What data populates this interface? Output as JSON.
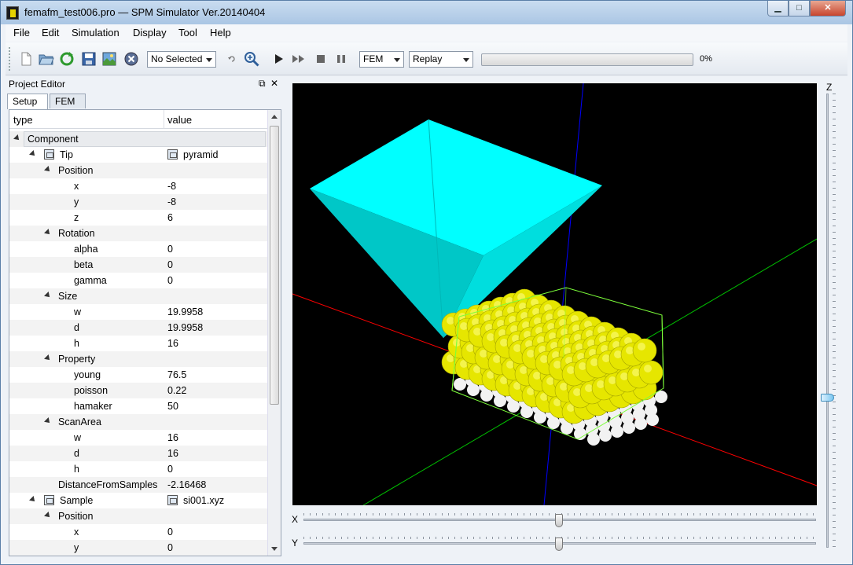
{
  "window": {
    "title": "femafm_test006.pro — SPM Simulator Ver.20140404",
    "min_glyph": "▁",
    "max_glyph": "□",
    "close_glyph": "✕"
  },
  "menu": [
    "File",
    "Edit",
    "Simulation",
    "Display",
    "Tool",
    "Help"
  ],
  "toolbar": {
    "selection_combo": "No Selected",
    "mode_combo": "FEM",
    "replay_combo": "Replay",
    "progress_value": 0,
    "progress_text": "0%"
  },
  "project_editor": {
    "title": "Project Editor",
    "float_glyph": "⧉",
    "close_glyph": "✕",
    "tabs": [
      "Setup",
      "FEM"
    ],
    "columns": {
      "type": "type",
      "value": "value"
    },
    "rows": [
      {
        "label": "Component",
        "value": ""
      },
      {
        "label": "Tip",
        "value": "pyramid"
      },
      {
        "label": "Position",
        "value": ""
      },
      {
        "label": "x",
        "value": "-8"
      },
      {
        "label": "y",
        "value": "-8"
      },
      {
        "label": "z",
        "value": "6"
      },
      {
        "label": "Rotation",
        "value": ""
      },
      {
        "label": "alpha",
        "value": "0"
      },
      {
        "label": "beta",
        "value": "0"
      },
      {
        "label": "gamma",
        "value": "0"
      },
      {
        "label": "Size",
        "value": ""
      },
      {
        "label": "w",
        "value": "19.9958"
      },
      {
        "label": "d",
        "value": "19.9958"
      },
      {
        "label": "h",
        "value": "16"
      },
      {
        "label": "Property",
        "value": ""
      },
      {
        "label": "young",
        "value": "76.5"
      },
      {
        "label": "poisson",
        "value": "0.22"
      },
      {
        "label": "hamaker",
        "value": "50"
      },
      {
        "label": "ScanArea",
        "value": ""
      },
      {
        "label": "w",
        "value": "16"
      },
      {
        "label": "d",
        "value": "16"
      },
      {
        "label": "h",
        "value": "0"
      },
      {
        "label": "DistanceFromSamples",
        "value": "-2.16468"
      },
      {
        "label": "Sample",
        "value": "si001.xyz"
      },
      {
        "label": "Position",
        "value": ""
      },
      {
        "label": "x",
        "value": "0"
      },
      {
        "label": "y",
        "value": "0"
      }
    ]
  },
  "view": {
    "x_label": "X",
    "y_label": "Y",
    "z_label": "Z",
    "colors": {
      "tip": "#00ffff",
      "atoms_top": "#e6e600",
      "atoms_bottom": "#f2f2f2",
      "axis_x": "#ff0000",
      "axis_y": "#00c000",
      "axis_z": "#0000ff",
      "bbox": "#7dff3a"
    }
  }
}
